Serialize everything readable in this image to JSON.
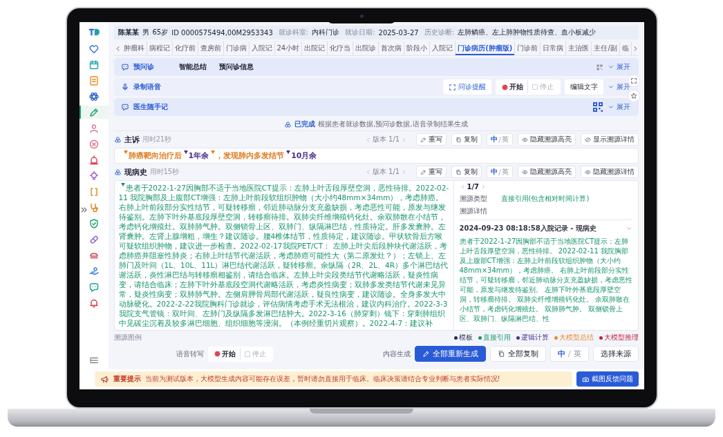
{
  "patient": {
    "name": "陈某某",
    "sex": "男",
    "age": "65岁",
    "id": "ID 0000575494,00M2953343",
    "fields": [
      {
        "label": "就诊科室:",
        "value": "内科门诊"
      },
      {
        "label": "就诊日期:",
        "value": "2025-03-27"
      },
      {
        "label": "历史诊断:",
        "value": "左肺鳞癌、左上肺肿物性质待查、血小板减少"
      }
    ]
  },
  "sidebar": [
    {
      "selected": false
    },
    {
      "selected": false
    },
    {
      "selected": false
    },
    {
      "selected": false
    },
    {
      "selected": true
    },
    {
      "selected": false
    },
    {
      "selected": false
    },
    {
      "selected": false
    },
    {
      "selected": false
    },
    {
      "selected": false
    },
    {
      "selected": false
    },
    {
      "selected": false
    },
    {
      "selected": false
    },
    {
      "selected": false
    },
    {
      "selected": false
    },
    {
      "selected": false
    },
    {
      "selected": false
    }
  ],
  "tabs": [
    {
      "label": "肿瘤科",
      "selected": false
    },
    {
      "label": "病程记",
      "selected": false
    },
    {
      "label": "化疗前",
      "selected": false
    },
    {
      "label": "查房前",
      "selected": false
    },
    {
      "label": "门诊病",
      "selected": false
    },
    {
      "label": "入院记",
      "selected": false
    },
    {
      "label": "24小时",
      "selected": false
    },
    {
      "label": "出院记",
      "selected": false
    },
    {
      "label": "化疗当",
      "selected": false
    },
    {
      "label": "出院诊",
      "selected": false
    },
    {
      "label": "首次病",
      "selected": false
    },
    {
      "label": "阶段小",
      "selected": false
    },
    {
      "label": "入院记",
      "selected": false
    },
    {
      "label": "门诊病历(肿瘤版)",
      "selected": true
    },
    {
      "label": "门诊前",
      "selected": false
    },
    {
      "label": "日常病",
      "selected": false
    },
    {
      "label": "主治医",
      "selected": false
    },
    {
      "label": "主任/副",
      "selected": false
    },
    {
      "label": "临",
      "selected": false
    }
  ],
  "preconsult": {
    "title": "预问诊",
    "tabs": [
      "智能总结",
      "预问诊信息"
    ],
    "expand": "展开"
  },
  "voice": {
    "title": "录制语音",
    "remind": "问诊提醒",
    "start": {
      "text": "开始",
      "disabled": false
    },
    "stop": {
      "text": "停止",
      "disabled": true
    },
    "edit": "编辑文字",
    "expand": "展开"
  },
  "notes": {
    "title": "医生随手记",
    "expand": "展开"
  },
  "status": {
    "done": "已完成",
    "text": "根据患者就诊数据,预问诊数据,语音录制结果生成"
  },
  "complaint": {
    "title": "主诉",
    "time": "用时21秒",
    "actions": [
      {
        "kind": "version",
        "text": "版本 1/1"
      },
      {
        "kind": "rewrite",
        "text": "重写"
      },
      {
        "kind": "copy",
        "text": "复制"
      },
      {
        "kind": "lang",
        "options": [
          {
            "text": "中",
            "selected": true
          },
          {
            "text": "英",
            "selected": false
          }
        ],
        "sep": "/"
      },
      {
        "kind": "eye",
        "text": "隐藏溯源高亮"
      },
      {
        "kind": "eye-off",
        "text": "显示溯源详情"
      }
    ],
    "segments": [
      {
        "text": "肺癌靶向治疗后",
        "color": "#e07b1e"
      },
      {
        "text": "1年余",
        "color": "#4b2f8f"
      },
      {
        "text": "，发现肺内多发结节",
        "color": "#e07b1e"
      },
      {
        "text": "10月余",
        "color": "#4b2f8f"
      }
    ]
  },
  "history": {
    "title": "现病史",
    "time": "用时15秒",
    "actions": [
      {
        "kind": "version",
        "text": "版本 1/1"
      },
      {
        "kind": "rewrite",
        "text": "重写"
      },
      {
        "kind": "copy",
        "text": "复制"
      },
      {
        "kind": "lang",
        "options": [
          {
            "text": "中",
            "selected": true
          },
          {
            "text": "英",
            "selected": false
          }
        ],
        "sep": "/"
      },
      {
        "kind": "eye",
        "text": "隐藏溯源高亮"
      },
      {
        "kind": "eye",
        "text": "隐藏溯源详情"
      }
    ],
    "text": "患者于2022-1-27因胸部不适于当地医院CT提示：左肺上叶舌段厚壁空洞，恶性待排。2022-02-11 我院胸部及上腹部CT增强：左肺上叶前段软组织肿物（大小约48mm×34mm），考虑肺癌。右肺上叶前段部分实性结节，可疑转移瘤，邻近肺动脉分支充盈缺损，考虑恶性可能，原发与继发待鉴别。左肺下叶外基底段厚壁空洞，转移瘤待排。双肺尖纤维增殖钙化灶。余双肺散在小结节，考虑钙化增殖灶。双肺肺气肿。双侧锁骨上区、双肺门、纵隔淋巴结，性质待定。肝多发囊肿。左肾囊肿。左肾上腺增粗，增生？建议随诊。腰4椎体结节，性质待定，建议随诊。甲状软骨后方喉可疑软组织肿物，建议进一步检查。2022-02-17我院PET/CT： 左肺上叶尖后段肿块代谢活跃，考虑肺癌并阻塞性肺炎；右肺上叶结节代谢活跃，考虑肺癌可能性大（第二原发灶？）；左锁上、左肺门及叶间（1L、10L、11L）淋巴结代谢活跃，疑转移瘤。余纵隔（2R、2L、4R）多个淋巴结代谢活跃，炎性淋巴结与转移瘤相鉴别，请结合临床。左肺上叶尖段类结节代谢略活跃，疑炎性病变，请结合临床；左肺下叶外基底段空洞代谢略活跃，考虑炎性病变；双肺多发类结节代谢未见异常，疑炎性病变；双肺肺气肿。左侧肩胛骨局部代谢活跃，疑良性病变，建议随诊。全身多发大中动脉硬化。2022-2-22我院胸科门诊就诊，评估病情考虑手术无法根治，建议内科治疗。2022-3-3我院支气管镜：双叶间、左肺门及纵隔多发淋巴结肿大。2022-3-16（肺穿刺）镜下：穿刺肺组织中见碳尘沉着及较多淋巴细胞、组织细胞等浸润。（本例经重切片观察）。2022-4-7：建议补",
    "source": {
      "pager": "1/7",
      "rows": [
        {
          "label": "溯源类型",
          "value": "直接引用(包含相对时间计算)"
        },
        {
          "label": "溯源详情"
        }
      ],
      "record": "2024-09-23 08:18:58入院记录 - 现病史",
      "text": "患者于2022-1-27因胸部不适于当地医院CT提示：左肺上叶舌段厚壁空洞，恶性待排。 2022-02-11 我院胸部及上腹部CT增强：左肺上叶前段软组织肿物（大小约48mm×34mm），考虑肺癌。 右肺上叶前段部分实性结节，可疑转移瘤，邻近肺动脉分支充盈缺损，考虑恶性可能，原发与继发待鉴别。 左肺下叶外基底段厚壁空洞，转移瘤待排。 双肺尖纤维增殖钙化灶。 余双肺散在小结节，考虑钙化增殖灶。 双肺肺气肿。 双侧锁骨上区、双肺门、纵隔淋巴结、性"
    }
  },
  "legend": {
    "title": "溯源图例",
    "items": [
      {
        "text": "模板",
        "color": "#2b2b4a"
      },
      {
        "text": "直接引用",
        "color": "#17956a"
      },
      {
        "text": "逻辑计算",
        "color": "#4b2f8f"
      },
      {
        "text": "大模型总结",
        "color": "#e8892c"
      },
      {
        "text": "大模型推理",
        "color": "#c01f3a"
      }
    ]
  },
  "footer": {
    "speech_label": "语音转写",
    "start": {
      "text": "开始",
      "disabled": false
    },
    "stop": {
      "text": "停止",
      "disabled": true
    },
    "gen_label": "内容生成",
    "regen": "全部重新生成",
    "copy_all": "全部复制",
    "lang": {
      "options": [
        {
          "text": "中",
          "selected": true
        },
        {
          "text": "英",
          "selected": false
        }
      ],
      "sep": "/"
    },
    "source": "选择来源"
  },
  "notice": {
    "title": "重要提示",
    "text": "当前为测试版本，大模型生成内容可能存在误差，暂时请勿直接用于临床。临床决策请结合专业判断与患者实际情况!",
    "button": "截图反馈问题"
  }
}
